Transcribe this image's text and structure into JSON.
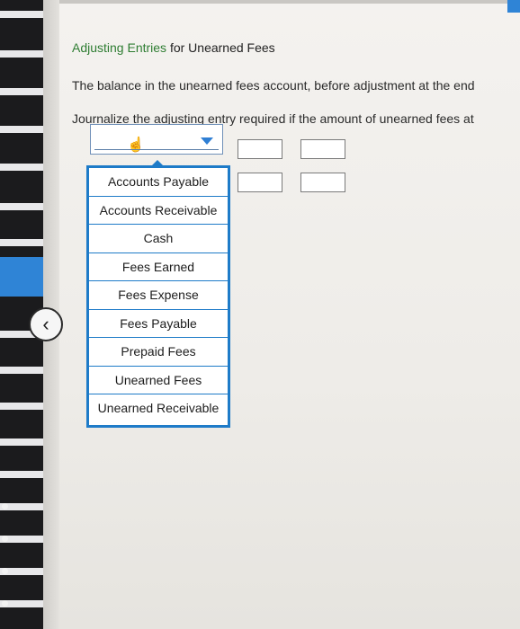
{
  "header": {
    "title_accent": "Adjusting Entries",
    "title_rest": " for Unearned Fees"
  },
  "content": {
    "line1": "The balance in the unearned fees account, before adjustment at the end",
    "line2": "Journalize the adjusting entry required if the amount of unearned fees at"
  },
  "account_select": {
    "selected_value": "",
    "options": [
      "Accounts Payable",
      "Accounts Receivable",
      "Cash",
      "Fees Earned",
      "Fees Expense",
      "Fees Payable",
      "Prepaid Fees",
      "Unearned Fees",
      "Unearned Receivable"
    ]
  },
  "colors": {
    "accent": "#2e7d32",
    "dropdown_border": "#1e7bc8"
  },
  "icons": {
    "cursor": "hand-pointer-icon",
    "dropdown": "caret-down-icon",
    "back": "chevron-left-icon"
  }
}
